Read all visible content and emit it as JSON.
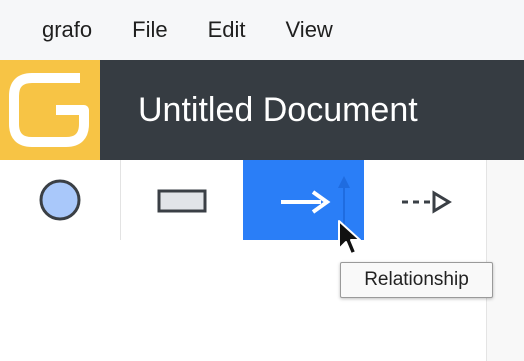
{
  "menubar": {
    "items": [
      {
        "label": "grafo"
      },
      {
        "label": "File"
      },
      {
        "label": "Edit"
      },
      {
        "label": "View"
      }
    ]
  },
  "header": {
    "title": "Untitled Document",
    "logo_color": "#f7c445",
    "background": "#363c42"
  },
  "toolbar": {
    "tools": [
      {
        "name": "node",
        "icon": "circle-node-icon",
        "active": false
      },
      {
        "name": "rectangle",
        "icon": "rectangle-icon",
        "active": false
      },
      {
        "name": "relationship",
        "icon": "arrow-right-icon",
        "active": true
      },
      {
        "name": "dashed-relationship",
        "icon": "dashed-arrow-icon",
        "active": false
      }
    ],
    "active_color": "#2a7ef7"
  },
  "tooltip": {
    "text": "Relationship"
  }
}
